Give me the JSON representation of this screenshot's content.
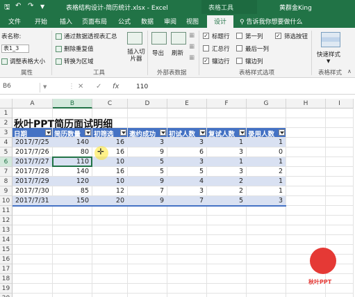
{
  "titlebar": {
    "doc_title": "表格结构设计-简历统计.xlsx - Excel",
    "context_label": "表格工具",
    "user": "黄群金King",
    "controls": [
      "save-icon",
      "undo-icon",
      "redo-icon",
      "customize-icon"
    ]
  },
  "tabs": [
    "文件",
    "开始",
    "插入",
    "页面布局",
    "公式",
    "数据",
    "审阅",
    "视图",
    "设计"
  ],
  "active_tab": "设计",
  "tell_me": "告诉我你想要做什么",
  "ribbon": {
    "properties": {
      "table_name_label": "表名称:",
      "table_name_value": "表1_3",
      "resize_label": "调整表格大小",
      "group_label": "属性"
    },
    "tools": {
      "pivot": "通过数据透视表汇总",
      "remove_dup": "删除重复值",
      "convert": "转换为区域",
      "slicer": "插入切片器",
      "group_label": "工具"
    },
    "external": {
      "export": "导出",
      "refresh": "刷新",
      "group_label": "外部表数据"
    },
    "style_options": {
      "header_row": "标题行",
      "total_row": "汇总行",
      "banded_rows": "镶边行",
      "first_col": "第一列",
      "last_col": "最后一列",
      "banded_cols": "镶边列",
      "filter_btn": "筛选按钮",
      "header_row_checked": true,
      "total_row_checked": false,
      "banded_rows_checked": true,
      "first_col_checked": false,
      "last_col_checked": false,
      "banded_cols_checked": false,
      "filter_btn_checked": true,
      "group_label": "表格样式选项"
    },
    "styles": {
      "quick_styles": "快速样式",
      "group_label": "表格样式"
    }
  },
  "formula_bar": {
    "name_box": "B6",
    "cancel": "✕",
    "enter": "✓",
    "fx": "fx",
    "value": "110"
  },
  "sheet": {
    "columns": [
      "A",
      "B",
      "C",
      "D",
      "E",
      "F",
      "G",
      "H",
      "I"
    ],
    "rows": [
      "1",
      "2",
      "3",
      "4",
      "5",
      "6",
      "7",
      "8",
      "9",
      "10",
      "11",
      "12",
      "13",
      "14",
      "15",
      "16",
      "17",
      "18",
      "19",
      "20"
    ],
    "title": "秋叶PPT简历面试明细",
    "headers": [
      "日期",
      "简历数量",
      "初筛选",
      "邀约成功",
      "初试人数",
      "复试人数",
      "录用人数"
    ],
    "data": [
      [
        "2017/7/25",
        "140",
        "16",
        "3",
        "3",
        "1",
        "1"
      ],
      [
        "2017/7/26",
        "80",
        "16",
        "9",
        "6",
        "3",
        "0"
      ],
      [
        "2017/7/27",
        "110",
        "10",
        "5",
        "3",
        "1",
        "1"
      ],
      [
        "2017/7/28",
        "140",
        "16",
        "5",
        "5",
        "3",
        "2"
      ],
      [
        "2017/7/29",
        "120",
        "10",
        "9",
        "4",
        "2",
        "1"
      ],
      [
        "2017/7/30",
        "85",
        "12",
        "7",
        "3",
        "2",
        "1"
      ],
      [
        "2017/7/31",
        "150",
        "20",
        "9",
        "7",
        "5",
        "3"
      ]
    ],
    "active_cell": "B6"
  },
  "logo_text": "秋叶PPT",
  "colors": {
    "excel_green": "#217346",
    "table_header": "#4472c4",
    "band": "#d9e1f2",
    "logo_red": "#e53935"
  }
}
